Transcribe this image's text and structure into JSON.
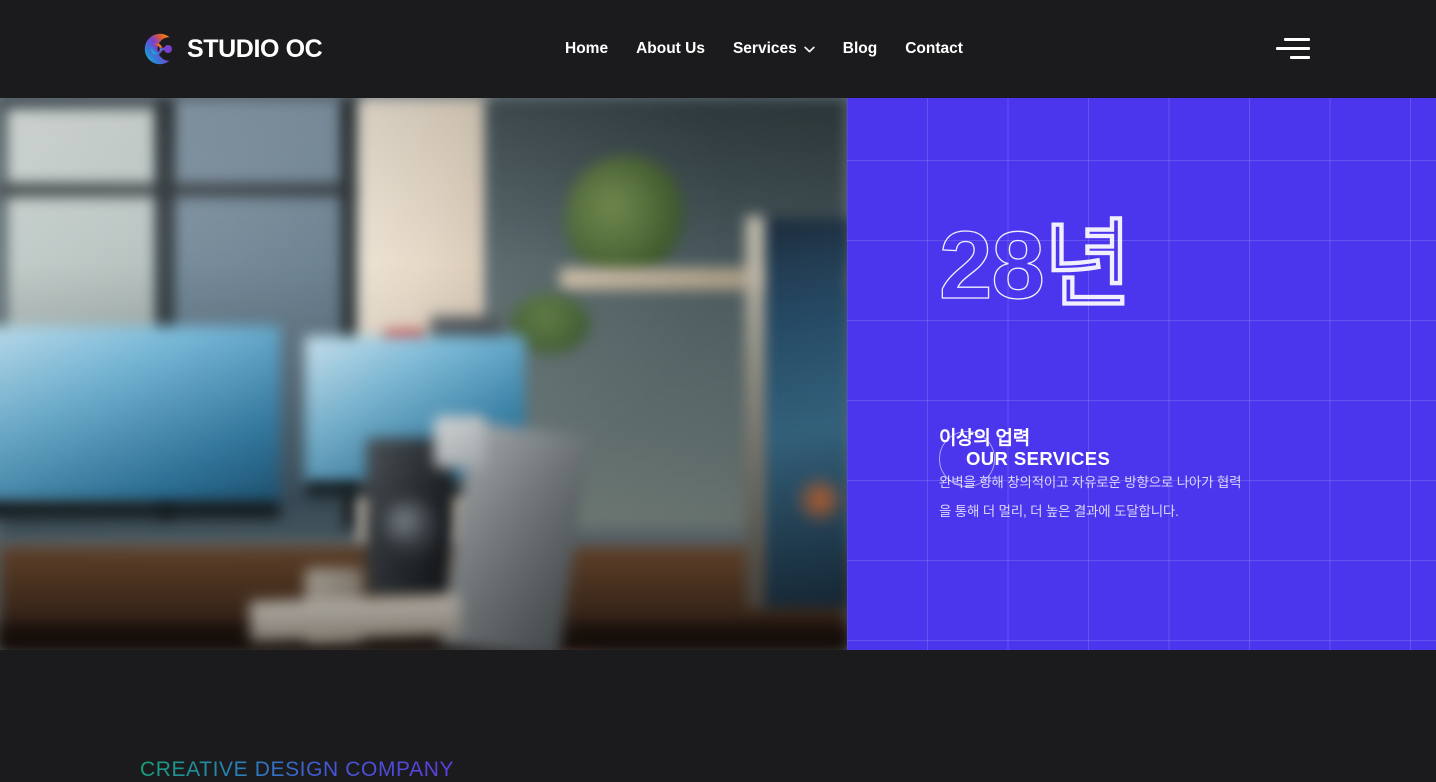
{
  "brand": {
    "name": "STUDIO OC",
    "logo_icon": "circular-gradient-c-logo"
  },
  "nav": {
    "items": [
      {
        "label": "Home",
        "has_dropdown": false
      },
      {
        "label": "About Us",
        "has_dropdown": false
      },
      {
        "label": "Services",
        "has_dropdown": true
      },
      {
        "label": "Blog",
        "has_dropdown": false
      },
      {
        "label": "Contact",
        "has_dropdown": false
      }
    ],
    "menu_toggle_icon": "hamburger-menu-icon",
    "dropdown_icon": "chevron-down-icon"
  },
  "hero": {
    "photo_alt": "blurred modern office desk with multiple monitors showing city skyline, speakers, plants and windows",
    "panel": {
      "headline_outline": "28년",
      "subheadline": "이상의 업력",
      "body": "완벽을 향해 창의적이고 자유로운 방향으로 나아가 협력을 통해 더 멀리, 더 높은 결과에 도달합니다.",
      "cta_label": "OUR SERVICES"
    }
  },
  "section_below": {
    "eyebrow": "CREATIVE DESIGN COMPANY"
  },
  "colors": {
    "background_dark": "#1b1b1d",
    "panel_purple": "#4b35ed",
    "text_white": "#ffffff",
    "gradient_start": "#17a07a",
    "gradient_end": "#5b3fe0",
    "grid_line": "rgba(255,255,255,0.14)"
  }
}
